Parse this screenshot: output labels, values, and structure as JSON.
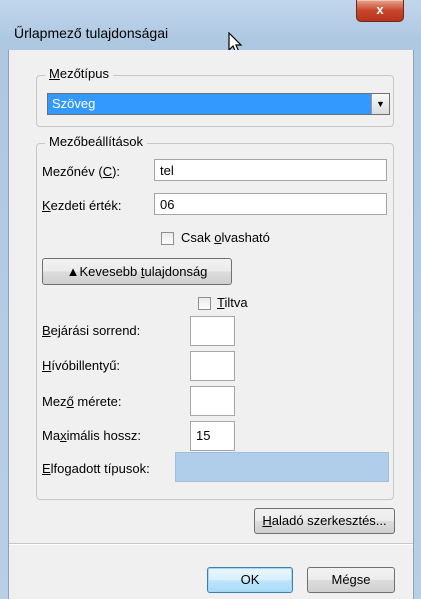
{
  "window": {
    "title": "Űrlapmező tulajdonságai",
    "close_glyph": "x"
  },
  "field_type": {
    "legend_pre": "",
    "legend_u": "M",
    "legend_post": "ezőtípus",
    "selected": "Szöveg",
    "arrow_glyph": "▼"
  },
  "settings": {
    "legend": "Mezőbeállítások",
    "name_label_pre": "Mezőnév (",
    "name_label_u": "C",
    "name_label_post": "):",
    "name_value": "tel",
    "default_label_u": "K",
    "default_label_post": "ezdeti érték:",
    "default_value": "06",
    "readonly_pre": "Csak ",
    "readonly_u": "o",
    "readonly_post": "lvasható",
    "less_button_pre": "▲Kevesebb ",
    "less_button_u": "t",
    "less_button_post": "ulajdonság",
    "disabled_u": "T",
    "disabled_post": "iltva",
    "tab_order_u": "B",
    "tab_order_post": "ejárási sorrend:",
    "tab_order_value": "",
    "hotkey_u": "H",
    "hotkey_post": "ívóbillentyű:",
    "hotkey_value": "",
    "size_pre": "Mez",
    "size_u": "ő",
    "size_post": " mérete:",
    "size_value": "",
    "maxlen_pre": "Ma",
    "maxlen_u": "x",
    "maxlen_post": "imális hossz:",
    "maxlen_value": "15",
    "accepted_u": "E",
    "accepted_post": "lfogadott típusok:",
    "accepted_value": ""
  },
  "buttons": {
    "advanced_u": "H",
    "advanced_post": "aladó szerkesztés...",
    "ok": "OK",
    "cancel": "Mégse"
  }
}
